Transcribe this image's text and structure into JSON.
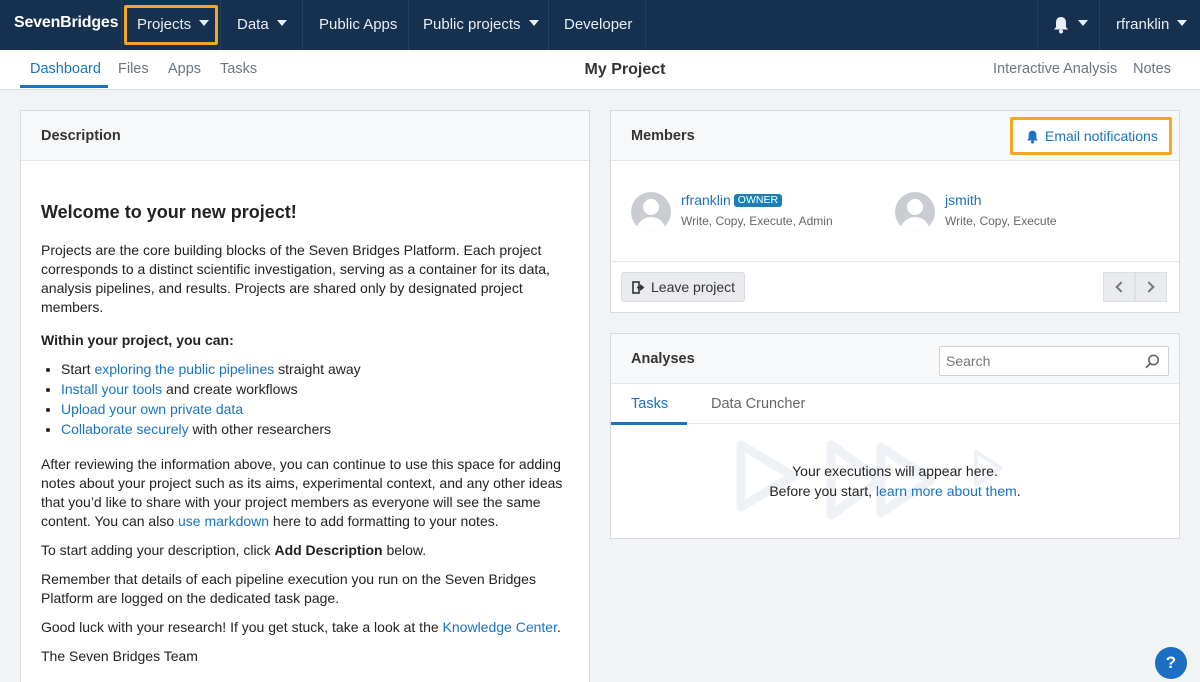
{
  "nav": {
    "brand": "SevenBridges",
    "items": [
      {
        "label": "Projects"
      },
      {
        "label": "Data"
      },
      {
        "label": "Public Apps"
      },
      {
        "label": "Public projects"
      },
      {
        "label": "Developer"
      }
    ],
    "user": "rfranklin"
  },
  "subnav": {
    "tabs": [
      "Dashboard",
      "Files",
      "Apps",
      "Tasks"
    ],
    "title": "My Project",
    "right": [
      "Interactive Analysis",
      "Notes"
    ]
  },
  "description": {
    "header": "Description",
    "heading": "Welcome to your new project!",
    "intro": "Projects are the core building blocks of the Seven Bridges Platform. Each project corresponds to a distinct scientific investigation, serving as a container for its data, analysis pipelines, and results. Projects are shared only by designated project members.",
    "within": "Within your project, you can:",
    "list": [
      {
        "pre": "Start ",
        "link": "exploring the public pipelines",
        "post": " straight away"
      },
      {
        "pre": "",
        "link": "Install your tools",
        "post": " and create workflows"
      },
      {
        "pre": "",
        "link": "Upload your own private data",
        "post": ""
      },
      {
        "pre": "",
        "link": "Collaborate securely",
        "post": " with other researchers"
      }
    ],
    "after": "After reviewing the information above, you can continue to use this space for adding notes about your project such as its aims, experimental context, and any other ideas that you’d like to share with your project members as everyone will see the same content. You can also ",
    "after_link": "use markdown",
    "after_end": " here to add formatting to your notes.",
    "start_pre": "To start adding your description, click ",
    "start_bold": "Add Description",
    "start_post": " below.",
    "remember": "Remember that details of each pipeline execution you run on the Seven Bridges Platform are logged on the dedicated task page.",
    "luck_pre": "Good luck with your research! If you get stuck, take a look at the ",
    "luck_link": "Knowledge Center",
    "luck_post": ".",
    "sign": "The Seven Bridges Team"
  },
  "members": {
    "header": "Members",
    "email_btn": "Email notifications",
    "list": [
      {
        "name": "rfranklin",
        "badge": "OWNER",
        "perms": "Write, Copy, Execute, Admin"
      },
      {
        "name": "jsmith",
        "badge": "",
        "perms": "Write, Copy, Execute"
      }
    ],
    "leave_btn": "Leave project"
  },
  "analyses": {
    "header": "Analyses",
    "search_placeholder": "Search",
    "tabs": [
      "Tasks",
      "Data Cruncher"
    ],
    "empty_line1": "Your executions will appear here.",
    "empty_pre": "Before you start, ",
    "empty_link": "learn more about them",
    "empty_post": "."
  },
  "help": "?"
}
